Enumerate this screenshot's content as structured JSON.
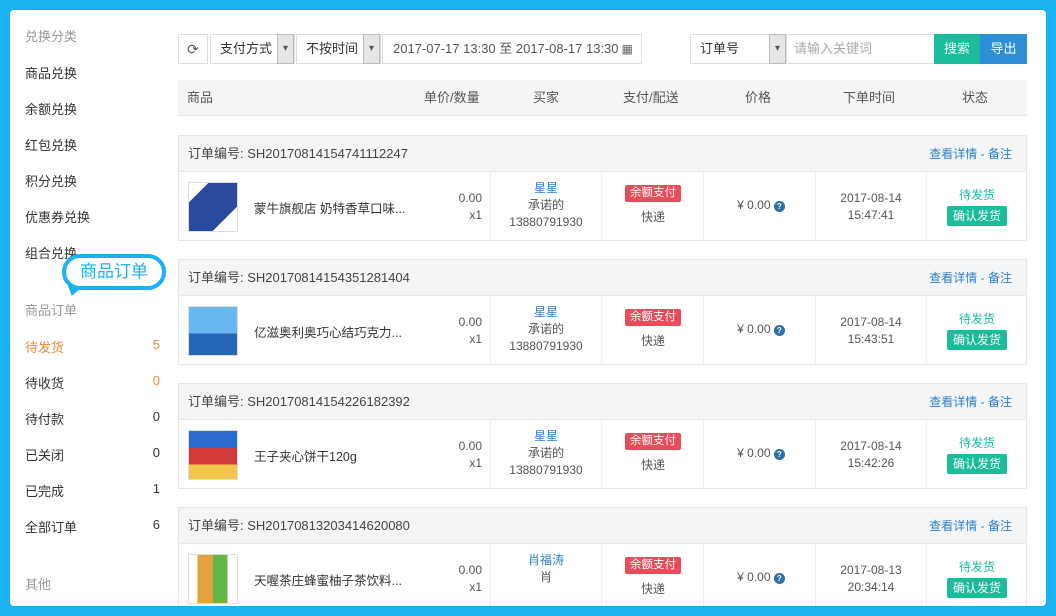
{
  "sidebar": {
    "section_exchange": "兑换分类",
    "exchange_items": [
      {
        "label": "商品兑换"
      },
      {
        "label": "余额兑换"
      },
      {
        "label": "红包兑换"
      },
      {
        "label": "积分兑换"
      },
      {
        "label": "优惠券兑换"
      },
      {
        "label": "组合兑换"
      }
    ],
    "callout": "商品订单",
    "section_orders": "商品订单",
    "order_items": [
      {
        "label": "待发货",
        "count": "5"
      },
      {
        "label": "待收货",
        "count": "0"
      },
      {
        "label": "待付款",
        "count": "0"
      },
      {
        "label": "已关闭",
        "count": "0"
      },
      {
        "label": "已完成",
        "count": "1"
      },
      {
        "label": "全部订单",
        "count": "6"
      }
    ],
    "section_other": "其他"
  },
  "toolbar": {
    "refresh_icon": "⟳",
    "payment_select": "支付方式",
    "time_select": "不按时间",
    "date_range": "2017-07-17 13:30 至 2017-08-17 13:30",
    "calendar_icon": "▦",
    "field_select": "订单号",
    "search_placeholder": "请输入关键词",
    "search_label": "搜索",
    "export_label": "导出",
    "caret": "▾"
  },
  "table": {
    "headers": [
      "商品",
      "单价/数量",
      "买家",
      "支付/配送",
      "价格",
      "下单时间",
      "状态"
    ]
  },
  "common": {
    "detail_link": "查看详情",
    "sep": " - ",
    "note_link": "备注",
    "pay_badge": "余额支付",
    "delivery": "快递",
    "ship_button": "确认发货",
    "qmark": "?"
  },
  "orders": [
    {
      "order_no": "订单编号: SH20170814154741112247",
      "product": "蒙牛旗舰店 奶特香草口味...",
      "unit_price": "0.00",
      "qty": "x1",
      "buyer_name": "星星",
      "buyer_sub": "承诺的",
      "buyer_phone": "13880791930",
      "amount": "¥ 0.00",
      "date": "2017-08-14",
      "time": "15:47:41",
      "status": "待发货"
    },
    {
      "order_no": "订单编号: SH20170814154351281404",
      "product": "亿滋奥利奥巧心结巧克力...",
      "unit_price": "0.00",
      "qty": "x1",
      "buyer_name": "星星",
      "buyer_sub": "承诺的",
      "buyer_phone": "13880791930",
      "amount": "¥ 0.00",
      "date": "2017-08-14",
      "time": "15:43:51",
      "status": "待发货"
    },
    {
      "order_no": "订单编号: SH20170814154226182392",
      "product": "王子夹心饼干120g",
      "unit_price": "0.00",
      "qty": "x1",
      "buyer_name": "星星",
      "buyer_sub": "承诺的",
      "buyer_phone": "13880791930",
      "amount": "¥ 0.00",
      "date": "2017-08-14",
      "time": "15:42:26",
      "status": "待发货"
    },
    {
      "order_no": "订单编号: SH20170813203414620080",
      "product": "天喔茶庄蜂蜜柚子茶饮料...",
      "unit_price": "0.00",
      "qty": "x1",
      "buyer_name": "肖福涛",
      "buyer_sub": "肖",
      "buyer_phone": "",
      "amount": "¥ 0.00",
      "date": "2017-08-13",
      "time": "20:34:14",
      "status": "待发货"
    }
  ],
  "colors": {
    "frame_blue": "#1ab2f0",
    "accent_orange": "#f0873a",
    "green": "#1bbc9b",
    "blue_button": "#2d8fd6",
    "link_blue": "#2d7fc8",
    "badge_red": "#e74c5b"
  }
}
